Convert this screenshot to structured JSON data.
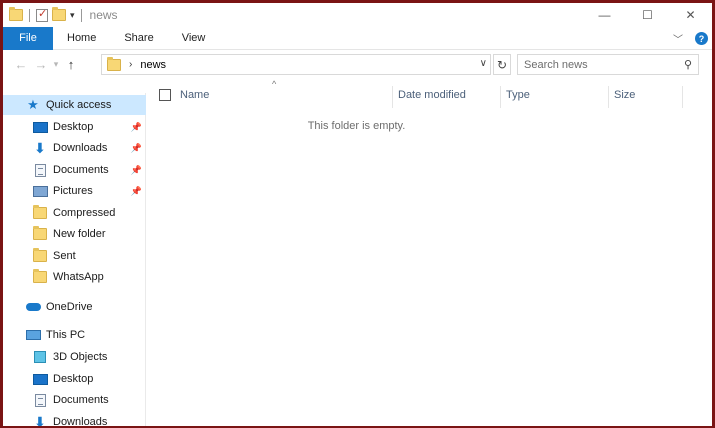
{
  "window": {
    "title": "news",
    "controls": {
      "minimize": "—",
      "maximize": "☐",
      "close": "✕"
    }
  },
  "ribbon": {
    "tabs": [
      "File",
      "Home",
      "Share",
      "View"
    ],
    "help": "?"
  },
  "address": {
    "path": "news"
  },
  "search": {
    "placeholder": "Search news"
  },
  "navpane": {
    "items": [
      {
        "label": "Quick access",
        "icon": "star-icon",
        "pinned": false
      },
      {
        "label": "Desktop",
        "icon": "desktop-icon",
        "pinned": true
      },
      {
        "label": "Downloads",
        "icon": "download-arrow-icon",
        "pinned": true
      },
      {
        "label": "Documents",
        "icon": "document-icon",
        "pinned": true
      },
      {
        "label": "Pictures",
        "icon": "pictures-icon",
        "pinned": true
      },
      {
        "label": "Compressed",
        "icon": "folder-icon",
        "pinned": false
      },
      {
        "label": "New folder",
        "icon": "folder-icon",
        "pinned": false
      },
      {
        "label": "Sent",
        "icon": "folder-icon",
        "pinned": false
      },
      {
        "label": "WhatsApp",
        "icon": "folder-icon",
        "pinned": false
      },
      {
        "label": "OneDrive",
        "icon": "cloud-icon",
        "pinned": false
      },
      {
        "label": "This PC",
        "icon": "computer-icon",
        "pinned": false
      },
      {
        "label": "3D Objects",
        "icon": "cube-icon",
        "pinned": false
      },
      {
        "label": "Desktop",
        "icon": "desktop-icon",
        "pinned": false
      },
      {
        "label": "Documents",
        "icon": "document-icon",
        "pinned": false
      },
      {
        "label": "Downloads",
        "icon": "download-arrow-icon",
        "pinned": false
      }
    ]
  },
  "content": {
    "columns": [
      "Name",
      "Date modified",
      "Type",
      "Size"
    ],
    "empty_message": "This folder is empty."
  },
  "colors": {
    "accent": "#1979ca",
    "selected_bg": "#cce8ff",
    "frame": "#7a1414"
  }
}
